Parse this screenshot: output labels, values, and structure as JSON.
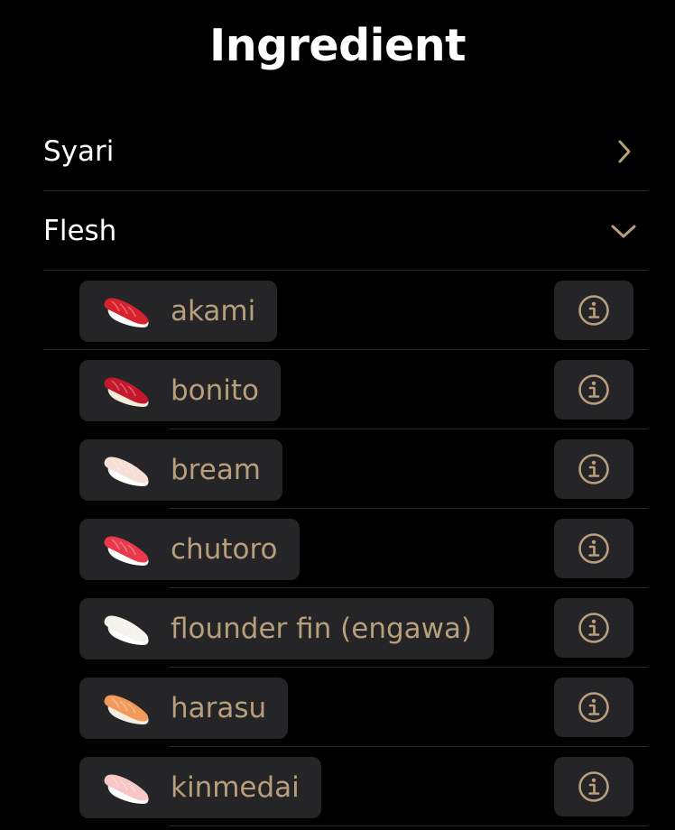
{
  "title": "Ingredient",
  "sections": [
    {
      "label": "Syari",
      "state": "collapsed",
      "icon": "chevron-right-icon"
    },
    {
      "label": "Flesh",
      "state": "expanded",
      "icon": "chevron-down-icon"
    }
  ],
  "flesh_items": [
    {
      "name": "akami",
      "icon": "tuna-sushi-icon",
      "colors": {
        "fish": "#d8212f",
        "rice": "#ffffff"
      }
    },
    {
      "name": "bonito",
      "icon": "bonito-sushi-icon",
      "colors": {
        "fish": "#c6182c",
        "rice": "#f3ecd8"
      }
    },
    {
      "name": "bream",
      "icon": "bream-sushi-icon",
      "colors": {
        "fish": "#f6dfd4",
        "rice": "#ffffff"
      }
    },
    {
      "name": "chutoro",
      "icon": "chutoro-sushi-icon",
      "colors": {
        "fish": "#e83a4a",
        "rice": "#ffffff"
      }
    },
    {
      "name": "flounder fin (engawa)",
      "icon": "engawa-sushi-icon",
      "colors": {
        "fish": "#f4f2ea",
        "rice": "#ffffff"
      }
    },
    {
      "name": "harasu",
      "icon": "harasu-sushi-icon",
      "colors": {
        "fish": "#f29a5a",
        "rice": "#f4efe2"
      }
    },
    {
      "name": "kinmedai",
      "icon": "kinmedai-sushi-icon",
      "colors": {
        "fish": "#f6c7c4",
        "rice": "#ffffff"
      }
    }
  ],
  "info_icon": "info-circle-icon",
  "colors": {
    "background": "#000000",
    "accent": "#b79f7c",
    "pill": "#252427",
    "divider": "#2e2c2a",
    "text": "#ffffff"
  }
}
